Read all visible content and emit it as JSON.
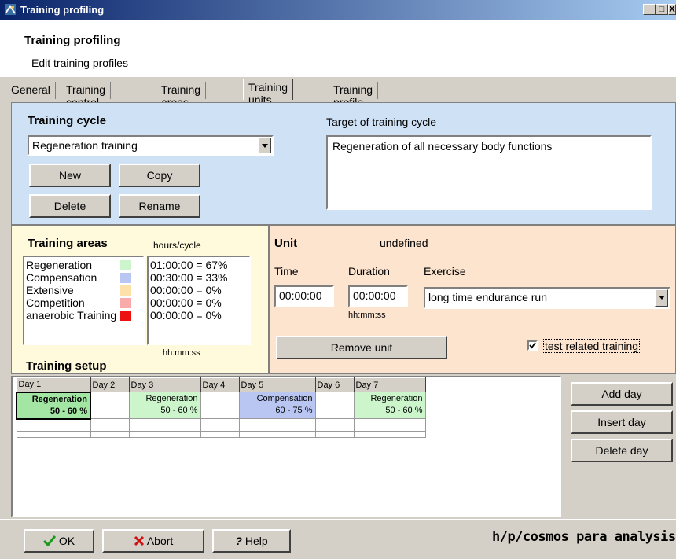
{
  "window": {
    "title": "Training profiling",
    "min_label": "_",
    "max_label": "□",
    "close_label": "X"
  },
  "header": {
    "title": "Training profiling",
    "subtitle": "Edit training profiles"
  },
  "tabs": [
    {
      "label": "General"
    },
    {
      "label": "Training control"
    },
    {
      "label": "Training areas"
    },
    {
      "label": "Training units",
      "active": true
    },
    {
      "label": "Training profile"
    }
  ],
  "cycle": {
    "heading": "Training cycle",
    "selected": "Regeneration training",
    "target_label": "Target of training cycle",
    "target_text": "Regeneration of all necessary body functions",
    "buttons": {
      "new": "New",
      "copy": "Copy",
      "delete": "Delete",
      "rename": "Rename"
    }
  },
  "areas": {
    "heading": "Training areas",
    "hours_label": "hours/cycle",
    "format": "hh:mm:ss",
    "items": [
      {
        "name": "Regeneration",
        "color": "#ccf5cc",
        "value": "01:00:00 = 67%"
      },
      {
        "name": "Compensation",
        "color": "#b9c6f2",
        "value": "00:30:00 = 33%"
      },
      {
        "name": "Extensive",
        "color": "#fde1a8",
        "value": "00:00:00 = 0%"
      },
      {
        "name": "Competition",
        "color": "#f9aaaa",
        "value": "00:00:00 = 0%"
      },
      {
        "name": "anaerobic Training",
        "color": "#ee1111",
        "value": "00:00:00 = 0%"
      }
    ]
  },
  "unit": {
    "heading": "Unit",
    "status": "undefined",
    "time_label": "Time",
    "time_value": "00:00:00",
    "duration_label": "Duration",
    "duration_value": "00:00:00",
    "duration_format": "hh:mm:ss",
    "exercise_label": "Exercise",
    "exercise_value": "long time endurance run",
    "remove_label": "Remove unit",
    "test_related_label": "test related training",
    "test_related_checked": true
  },
  "setup": {
    "heading": "Training setup",
    "days": [
      {
        "label": "Day 1",
        "unit": "Regeneration",
        "range": "50 - 60 %",
        "color": "#a3e6a3",
        "selected": true
      },
      {
        "label": "Day 2",
        "unit": "",
        "range": "",
        "color": ""
      },
      {
        "label": "Day 3",
        "unit": "Regeneration",
        "range": "50 - 60 %",
        "color": "#ccf5cc"
      },
      {
        "label": "Day 4",
        "unit": "",
        "range": "",
        "color": ""
      },
      {
        "label": "Day 5",
        "unit": "Compensation",
        "range": "60 - 75 %",
        "color": "#b9c6f2"
      },
      {
        "label": "Day 6",
        "unit": "",
        "range": "",
        "color": ""
      },
      {
        "label": "Day 7",
        "unit": "Regeneration",
        "range": "50 - 60 %",
        "color": "#ccf5cc"
      }
    ],
    "buttons": {
      "add": "Add day",
      "insert": "Insert day",
      "delete": "Delete day"
    }
  },
  "footer": {
    "ok": "OK",
    "abort": "Abort",
    "help": "Help",
    "brand": "h/p/cosmos para analysis"
  }
}
